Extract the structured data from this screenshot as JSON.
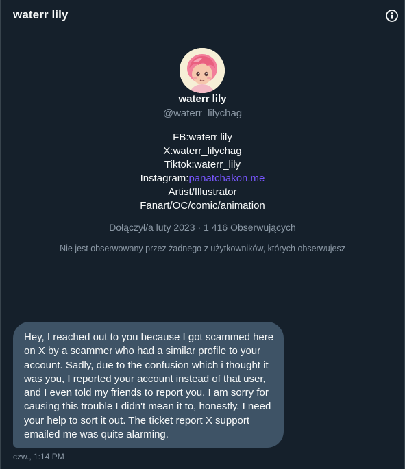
{
  "header": {
    "title": "waterr lily",
    "info_icon": "info-circle-icon"
  },
  "profile": {
    "avatar_icon": "avatar-pink-hair-girl",
    "display_name": "waterr lily",
    "handle": "@waterr_lilychag",
    "bio": {
      "line1": "FB:waterr lily",
      "line2": "X:waterr_lilychag",
      "line3": "Tiktok:waterr_lily",
      "instagram_label": "Instagram:",
      "instagram_link": "panatchakon.me",
      "line5": "Artist/Illustrator",
      "line6": "Fanart/OC/comic/animation"
    },
    "joined": "Dołączył/a luty 2023",
    "separator": "·",
    "followers": "1 416 Obserwujących",
    "not_followed_note": "Nie jest obserwowany przez żadnego z użytkowników, których obserwujesz"
  },
  "message": {
    "text": "Hey, I reached out to you because I got scammed here on X by a scammer who had a similar profile to your account. Sadly, due to the confusion which i thought it was you, I reported your account instead of that user, and I even told my friends to report you. I am sorry for causing this trouble I didn't mean it to, honestly. I need your help to sort it out. The ticket report X support emailed me was quite alarming.",
    "timestamp": "czw., 1:14 PM"
  },
  "colors": {
    "background": "#15202b",
    "bubble": "#3e5366",
    "secondary_text": "#8b98a5",
    "link": "#7856ff",
    "divider": "#38444d"
  }
}
